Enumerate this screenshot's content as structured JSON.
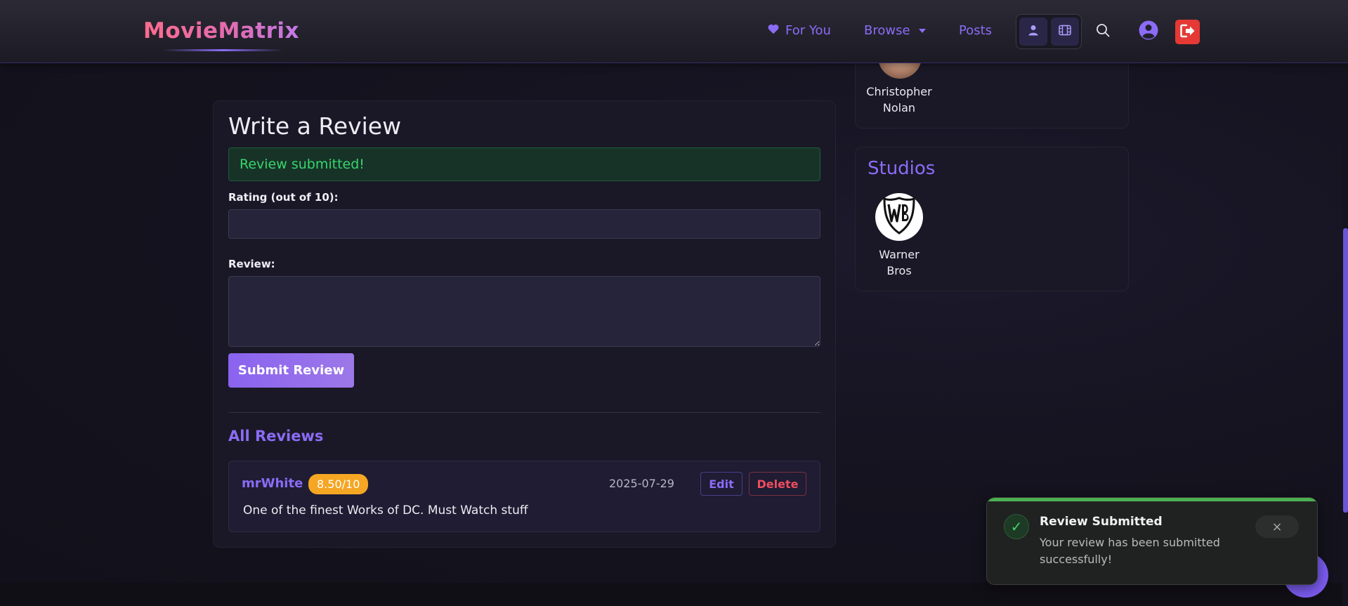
{
  "app": {
    "brand": "MovieMatrix",
    "colors": {
      "accent": "#8b6cf6",
      "success": "#37d66e",
      "danger": "#e53935",
      "badge": "#f5a623"
    }
  },
  "nav": {
    "for_you": "For You",
    "browse": "Browse",
    "posts": "Posts",
    "icons": [
      "heart-icon",
      "chevron-down-icon",
      "person-icon",
      "film-icon",
      "search-icon",
      "user-circle-icon",
      "logout-icon"
    ]
  },
  "review_form": {
    "title": "Write a Review",
    "alert": "Review submitted!",
    "rating_label": "Rating (out of 10):",
    "rating_value": "",
    "review_label": "Review:",
    "review_value": "",
    "submit_label": "Submit Review"
  },
  "reviews": {
    "title": "All Reviews",
    "items": [
      {
        "user": "mrWhite",
        "score": "8.50/10",
        "date": "2025-07-29",
        "text": "One of the finest Works of DC. Must Watch stuff",
        "edit_label": "Edit",
        "delete_label": "Delete"
      }
    ]
  },
  "sidebar": {
    "director": {
      "name_line1": "Christopher",
      "name_line2": "Nolan"
    },
    "studios": {
      "title": "Studios",
      "items": [
        {
          "name_line1": "Warner",
          "name_line2": "Bros"
        }
      ]
    }
  },
  "toast": {
    "title": "Review Submitted",
    "message": "Your review has been submitted successfully!",
    "close": "×",
    "check": "✓"
  }
}
